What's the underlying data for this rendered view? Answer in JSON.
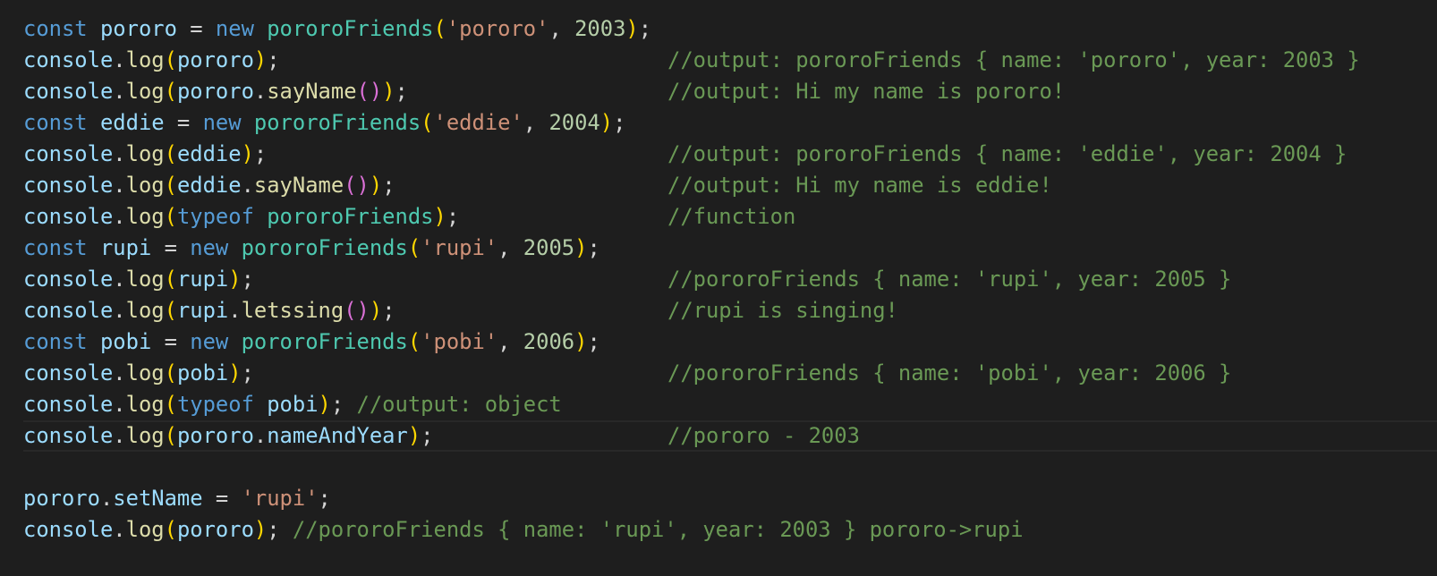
{
  "theme": {
    "background": "#1e1e1e",
    "keyword": "#569cd6",
    "variable": "#9cdcfe",
    "class": "#4ec9b0",
    "function": "#dcdcaa",
    "string": "#ce9178",
    "number": "#b5cea8",
    "comment": "#6a9955",
    "bracket_1": "#ffd700",
    "bracket_2": "#da70d6"
  },
  "editor": {
    "current_line": 14,
    "lines": [
      {
        "tokens": [
          [
            "k",
            "const"
          ],
          [
            "p",
            " "
          ],
          [
            "v",
            "pororo"
          ],
          [
            "p",
            " = "
          ],
          [
            "k",
            "new"
          ],
          [
            "p",
            " "
          ],
          [
            "c",
            "pororoFriends"
          ],
          [
            "b1",
            "("
          ],
          [
            "s",
            "'pororo'"
          ],
          [
            "p",
            ", "
          ],
          [
            "n",
            "2003"
          ],
          [
            "b1",
            ")"
          ],
          [
            "p",
            ";"
          ]
        ],
        "comment": ""
      },
      {
        "tokens": [
          [
            "v",
            "console"
          ],
          [
            "p",
            "."
          ],
          [
            "f",
            "log"
          ],
          [
            "b1",
            "("
          ],
          [
            "v",
            "pororo"
          ],
          [
            "b1",
            ")"
          ],
          [
            "p",
            ";"
          ]
        ],
        "comment": "//output: pororoFriends { name: 'pororo', year: 2003 }"
      },
      {
        "tokens": [
          [
            "v",
            "console"
          ],
          [
            "p",
            "."
          ],
          [
            "f",
            "log"
          ],
          [
            "b1",
            "("
          ],
          [
            "v",
            "pororo"
          ],
          [
            "p",
            "."
          ],
          [
            "f",
            "sayName"
          ],
          [
            "b2",
            "()"
          ],
          [
            "b1",
            ")"
          ],
          [
            "p",
            ";"
          ]
        ],
        "comment": "//output: Hi my name is pororo!"
      },
      {
        "tokens": [
          [
            "k",
            "const"
          ],
          [
            "p",
            " "
          ],
          [
            "v",
            "eddie"
          ],
          [
            "p",
            " = "
          ],
          [
            "k",
            "new"
          ],
          [
            "p",
            " "
          ],
          [
            "c",
            "pororoFriends"
          ],
          [
            "b1",
            "("
          ],
          [
            "s",
            "'eddie'"
          ],
          [
            "p",
            ", "
          ],
          [
            "n",
            "2004"
          ],
          [
            "b1",
            ")"
          ],
          [
            "p",
            ";"
          ]
        ],
        "comment": ""
      },
      {
        "tokens": [
          [
            "v",
            "console"
          ],
          [
            "p",
            "."
          ],
          [
            "f",
            "log"
          ],
          [
            "b1",
            "("
          ],
          [
            "v",
            "eddie"
          ],
          [
            "b1",
            ")"
          ],
          [
            "p",
            ";"
          ]
        ],
        "comment": "//output: pororoFriends { name: 'eddie', year: 2004 }"
      },
      {
        "tokens": [
          [
            "v",
            "console"
          ],
          [
            "p",
            "."
          ],
          [
            "f",
            "log"
          ],
          [
            "b1",
            "("
          ],
          [
            "v",
            "eddie"
          ],
          [
            "p",
            "."
          ],
          [
            "f",
            "sayName"
          ],
          [
            "b2",
            "()"
          ],
          [
            "b1",
            ")"
          ],
          [
            "p",
            ";"
          ]
        ],
        "comment": "//output: Hi my name is eddie!"
      },
      {
        "tokens": [
          [
            "v",
            "console"
          ],
          [
            "p",
            "."
          ],
          [
            "f",
            "log"
          ],
          [
            "b1",
            "("
          ],
          [
            "k",
            "typeof"
          ],
          [
            "p",
            " "
          ],
          [
            "c",
            "pororoFriends"
          ],
          [
            "b1",
            ")"
          ],
          [
            "p",
            ";"
          ]
        ],
        "comment": "//function"
      },
      {
        "tokens": [
          [
            "k",
            "const"
          ],
          [
            "p",
            " "
          ],
          [
            "v",
            "rupi"
          ],
          [
            "p",
            " = "
          ],
          [
            "k",
            "new"
          ],
          [
            "p",
            " "
          ],
          [
            "c",
            "pororoFriends"
          ],
          [
            "b1",
            "("
          ],
          [
            "s",
            "'rupi'"
          ],
          [
            "p",
            ", "
          ],
          [
            "n",
            "2005"
          ],
          [
            "b1",
            ")"
          ],
          [
            "p",
            ";"
          ]
        ],
        "comment": ""
      },
      {
        "tokens": [
          [
            "v",
            "console"
          ],
          [
            "p",
            "."
          ],
          [
            "f",
            "log"
          ],
          [
            "b1",
            "("
          ],
          [
            "v",
            "rupi"
          ],
          [
            "b1",
            ")"
          ],
          [
            "p",
            ";"
          ]
        ],
        "comment": "//pororoFriends { name: 'rupi', year: 2005 }"
      },
      {
        "tokens": [
          [
            "v",
            "console"
          ],
          [
            "p",
            "."
          ],
          [
            "f",
            "log"
          ],
          [
            "b1",
            "("
          ],
          [
            "v",
            "rupi"
          ],
          [
            "p",
            "."
          ],
          [
            "f",
            "letssing"
          ],
          [
            "b2",
            "()"
          ],
          [
            "b1",
            ")"
          ],
          [
            "p",
            ";"
          ]
        ],
        "comment": "//rupi is singing!"
      },
      {
        "tokens": [
          [
            "k",
            "const"
          ],
          [
            "p",
            " "
          ],
          [
            "v",
            "pobi"
          ],
          [
            "p",
            " = "
          ],
          [
            "k",
            "new"
          ],
          [
            "p",
            " "
          ],
          [
            "c",
            "pororoFriends"
          ],
          [
            "b1",
            "("
          ],
          [
            "s",
            "'pobi'"
          ],
          [
            "p",
            ", "
          ],
          [
            "n",
            "2006"
          ],
          [
            "b1",
            ")"
          ],
          [
            "p",
            ";"
          ]
        ],
        "comment": ""
      },
      {
        "tokens": [
          [
            "v",
            "console"
          ],
          [
            "p",
            "."
          ],
          [
            "f",
            "log"
          ],
          [
            "b1",
            "("
          ],
          [
            "v",
            "pobi"
          ],
          [
            "b1",
            ")"
          ],
          [
            "p",
            ";"
          ]
        ],
        "comment": "//pororoFriends { name: 'pobi', year: 2006 }"
      },
      {
        "tokens": [
          [
            "v",
            "console"
          ],
          [
            "p",
            "."
          ],
          [
            "f",
            "log"
          ],
          [
            "b1",
            "("
          ],
          [
            "k",
            "typeof"
          ],
          [
            "p",
            " "
          ],
          [
            "v",
            "pobi"
          ],
          [
            "b1",
            ")"
          ],
          [
            "p",
            "; "
          ],
          [
            "cm",
            "//output: object"
          ]
        ],
        "comment": ""
      },
      {
        "tokens": [
          [
            "v",
            "console"
          ],
          [
            "p",
            "."
          ],
          [
            "f",
            "log"
          ],
          [
            "b1",
            "("
          ],
          [
            "v",
            "pororo"
          ],
          [
            "p",
            "."
          ],
          [
            "v",
            "nameAndYear"
          ],
          [
            "b1",
            ")"
          ],
          [
            "p",
            ";"
          ]
        ],
        "comment": "//pororo - 2003"
      },
      {
        "tokens": [],
        "comment": ""
      },
      {
        "tokens": [
          [
            "v",
            "pororo"
          ],
          [
            "p",
            "."
          ],
          [
            "v",
            "setName"
          ],
          [
            "p",
            " = "
          ],
          [
            "s",
            "'rupi'"
          ],
          [
            "p",
            ";"
          ]
        ],
        "comment": ""
      },
      {
        "tokens": [
          [
            "v",
            "console"
          ],
          [
            "p",
            "."
          ],
          [
            "f",
            "log"
          ],
          [
            "b1",
            "("
          ],
          [
            "v",
            "pororo"
          ],
          [
            "b1",
            ")"
          ],
          [
            "p",
            "; "
          ],
          [
            "cm",
            "//pororoFriends { name: 'rupi', year: 2003 } pororo->rupi"
          ]
        ],
        "comment": ""
      }
    ]
  }
}
